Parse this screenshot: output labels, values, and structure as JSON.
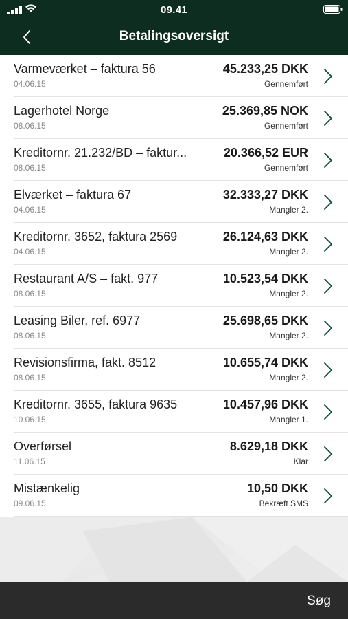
{
  "status_bar": {
    "time": "09.41"
  },
  "header": {
    "title": "Betalingsoversigt",
    "back_icon": "chevron-left-icon"
  },
  "payments": [
    {
      "name": "Varmeværket – faktura 56",
      "date": "04.06.15",
      "amount": "45.233,25 DKK",
      "status": "Gennemført"
    },
    {
      "name": "Lagerhotel Norge",
      "date": "08.06.15",
      "amount": "25.369,85 NOK",
      "status": "Gennemført"
    },
    {
      "name": "Kreditornr. 21.232/BD – faktur...",
      "date": "08.06.15",
      "amount": "20.366,52 EUR",
      "status": "Gennemført"
    },
    {
      "name": "Elværket – faktura 67",
      "date": "04.06.15",
      "amount": "32.333,27 DKK",
      "status": "Mangler 2."
    },
    {
      "name": "Kreditornr. 3652, faktura 2569",
      "date": "04.06.15",
      "amount": "26.124,63 DKK",
      "status": "Mangler 2."
    },
    {
      "name": "Restaurant A/S – fakt. 977",
      "date": "08.06.15",
      "amount": "10.523,54 DKK",
      "status": "Mangler 2."
    },
    {
      "name": "Leasing Biler, ref. 6977",
      "date": "08.06.15",
      "amount": "25.698,65 DKK",
      "status": "Mangler 2."
    },
    {
      "name": "Revisionsfirma, fakt. 8512",
      "date": "08.06.15",
      "amount": "10.655,74 DKK",
      "status": "Mangler 2."
    },
    {
      "name": "Kreditornr. 3655, faktura 9635",
      "date": "10.06.15",
      "amount": "10.457,96 DKK",
      "status": "Mangler 1."
    },
    {
      "name": "Overførsel",
      "date": "11.06.15",
      "amount": "8.629,18 DKK",
      "status": "Klar"
    },
    {
      "name": "Mistænkelig",
      "date": "09.06.15",
      "amount": "10,50 DKK",
      "status": "Bekræft SMS"
    }
  ],
  "tab_bar": {
    "search_label": "Søg"
  },
  "colors": {
    "header_bg": "#0c2d20",
    "tabbar_bg": "#2b2b2b",
    "chevron": "#0c4a32"
  }
}
